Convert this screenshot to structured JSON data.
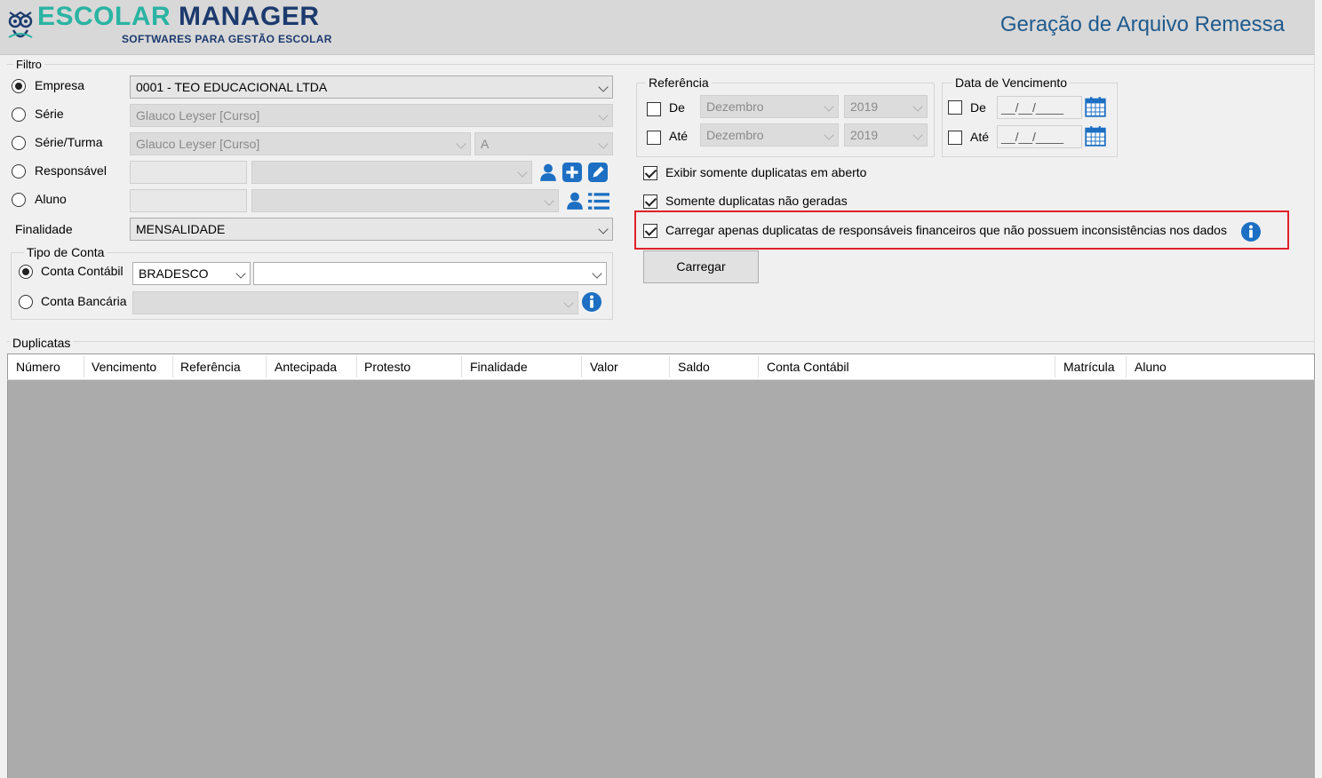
{
  "header": {
    "logo_a": "ESCOLAR",
    "logo_b": "MANAGER",
    "logo_sub": "SOFTWARES PARA GESTÃO ESCOLAR",
    "title": "Geração de Arquivo Remessa"
  },
  "filtro": {
    "label": "Filtro",
    "empresa": {
      "label": "Empresa",
      "value": "0001 - TEO EDUCACIONAL LTDA",
      "selected": true
    },
    "serie": {
      "label": "Série",
      "value": "Glauco Leyser [Curso]"
    },
    "serie_turma": {
      "label": "Série/Turma",
      "value": "Glauco Leyser [Curso]",
      "turma": "A"
    },
    "responsavel": {
      "label": "Responsável"
    },
    "aluno": {
      "label": "Aluno"
    },
    "finalidade": {
      "label": "Finalidade",
      "value": "MENSALIDADE"
    },
    "tipo_conta": {
      "label": "Tipo de Conta",
      "contabil": {
        "label": "Conta Contábil",
        "value": "BRADESCO",
        "selected": true
      },
      "bancaria": {
        "label": "Conta Bancária"
      }
    }
  },
  "referencia": {
    "label": "Referência",
    "de": {
      "label": "De",
      "month": "Dezembro",
      "year": "2019"
    },
    "ate": {
      "label": "Até",
      "month": "Dezembro",
      "year": "2019"
    }
  },
  "vencimento": {
    "label": "Data de Vencimento",
    "de": {
      "label": "De",
      "value": "__/__/____"
    },
    "ate": {
      "label": "Até",
      "value": "__/__/____"
    }
  },
  "options": {
    "exibir_aberto": "Exibir somente duplicatas em aberto",
    "nao_geradas": "Somente duplicatas não geradas",
    "carregar_apenas": "Carregar apenas duplicatas de responsáveis financeiros que não possuem inconsistências nos dados"
  },
  "carregar_button": "Carregar",
  "duplicatas": {
    "label": "Duplicatas",
    "columns": [
      "Número",
      "Vencimento",
      "Referência",
      "Antecipada",
      "Protesto",
      "Finalidade",
      "Valor",
      "Saldo",
      "Conta Contábil",
      "Matrícula",
      "Aluno"
    ]
  },
  "colors": {
    "accent": "#1f5a8c",
    "highlight": "#e0202a",
    "icon_blue": "#1c6fc2"
  }
}
